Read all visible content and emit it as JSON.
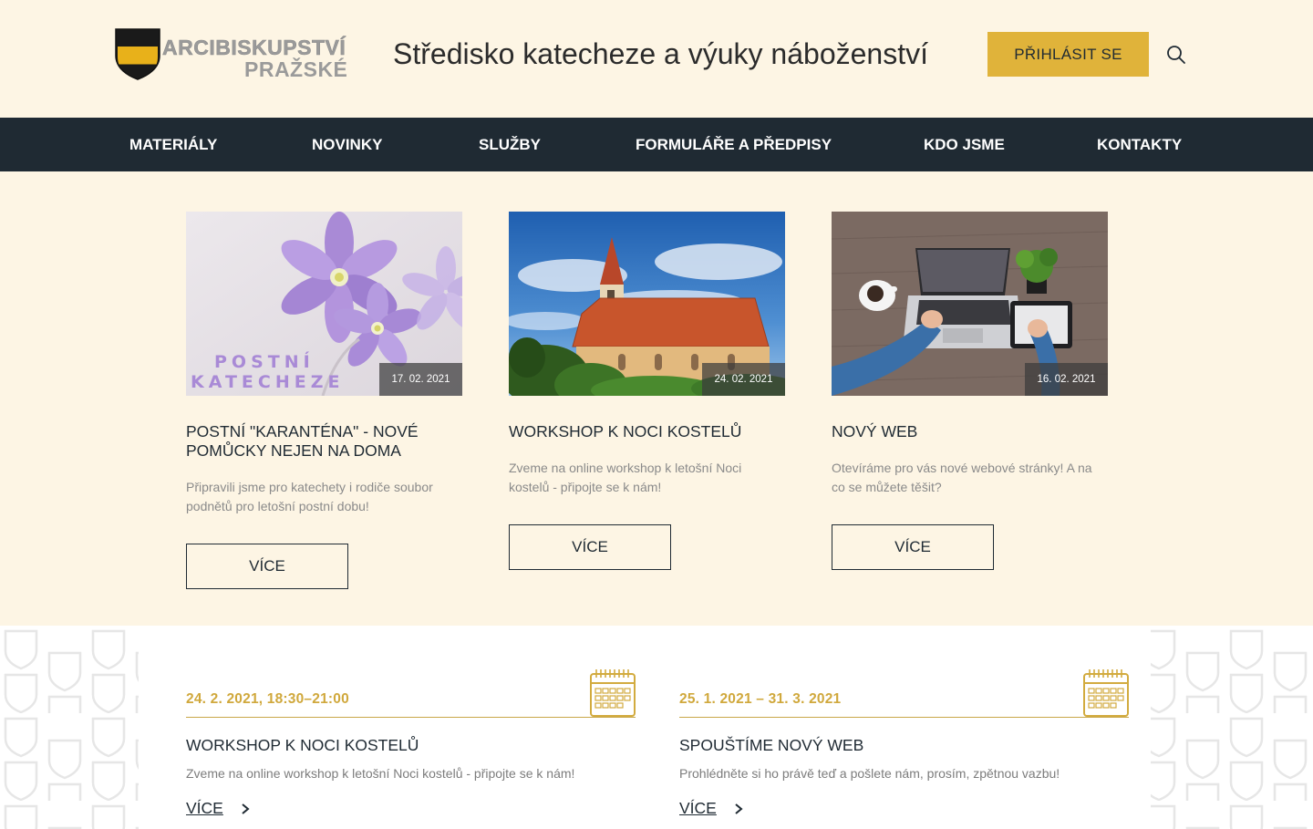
{
  "header": {
    "logo_line1": "ARCIBISKUPSTVÍ",
    "logo_line2": "PRAŽSKÉ",
    "site_title": "Středisko katecheze a výuky náboženství",
    "login_label": "PŘIHLÁSIT SE",
    "search_icon": "search-icon",
    "accent_color": "#e0b33a"
  },
  "nav": {
    "items": [
      {
        "label": "MATERIÁLY"
      },
      {
        "label": "NOVINKY"
      },
      {
        "label": "SLUŽBY"
      },
      {
        "label": "FORMULÁŘE A PŘEDPISY"
      },
      {
        "label": "KDO JSME"
      },
      {
        "label": "KONTAKTY"
      }
    ],
    "background": "#1f2a33"
  },
  "cards": [
    {
      "image_caption_line1": "POSTNÍ",
      "image_caption_line2": "KATECHEZE",
      "date": "17. 02. 2021",
      "title": "POSTNÍ \"KARANTÉNA\" - NOVÉ POMŮCKY NEJEN NA DOMA",
      "text": "Připravili jsme pro katechety i rodiče soubor podnětů pro letošní postní dobu!",
      "button": "VÍCE"
    },
    {
      "date": "24. 02. 2021",
      "title": "WORKSHOP K NOCI KOSTELŮ",
      "text": "Zveme na online workshop k letošní Noci kostelů - připojte se k nám!",
      "button": "VÍCE"
    },
    {
      "date": "16. 02. 2021",
      "title": "NOVÝ WEB",
      "text": "Otevíráme pro vás nové webové stránky! A na co se můžete těšit?",
      "button": "VÍCE"
    }
  ],
  "events": [
    {
      "date": "24. 2. 2021, 18:30–21:00",
      "title": "WORKSHOP K NOCI KOSTELŮ",
      "text": "Zveme na online workshop k letošní Noci kostelů - připojte se k nám!",
      "link": "VÍCE"
    },
    {
      "date": "25. 1. 2021 – 31. 3. 2021",
      "title": "SPOUŠTÍME NOVÝ WEB",
      "text": "Prohlédněte si ho právě teď a pošlete nám, prosím, zpětnou vazbu!",
      "link": "VÍCE"
    }
  ]
}
